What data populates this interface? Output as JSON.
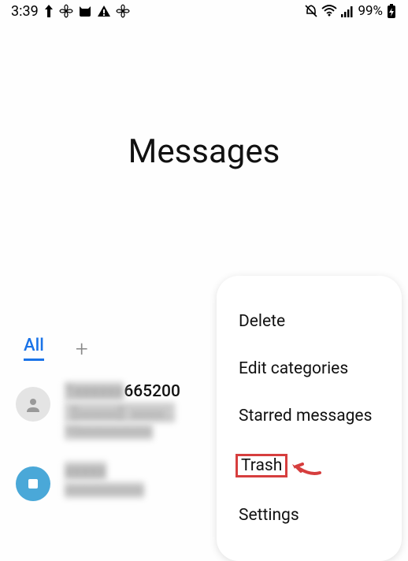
{
  "status": {
    "time": "3:39",
    "battery": "99%"
  },
  "header": {
    "title": "Messages"
  },
  "tabs": {
    "all": "All",
    "add": "+"
  },
  "messages": [
    {
      "sender_partial": "665200",
      "preview1": "【xxxxxx】xxxxx...",
      "preview2": "10xxxxxxxxxxx"
    },
    {
      "sender_partial": "xxxxx",
      "preview1": "xxxxxxxxxxxx"
    }
  ],
  "menu": {
    "items": [
      "Delete",
      "Edit categories",
      "Starred messages",
      "Trash",
      "Settings"
    ]
  }
}
